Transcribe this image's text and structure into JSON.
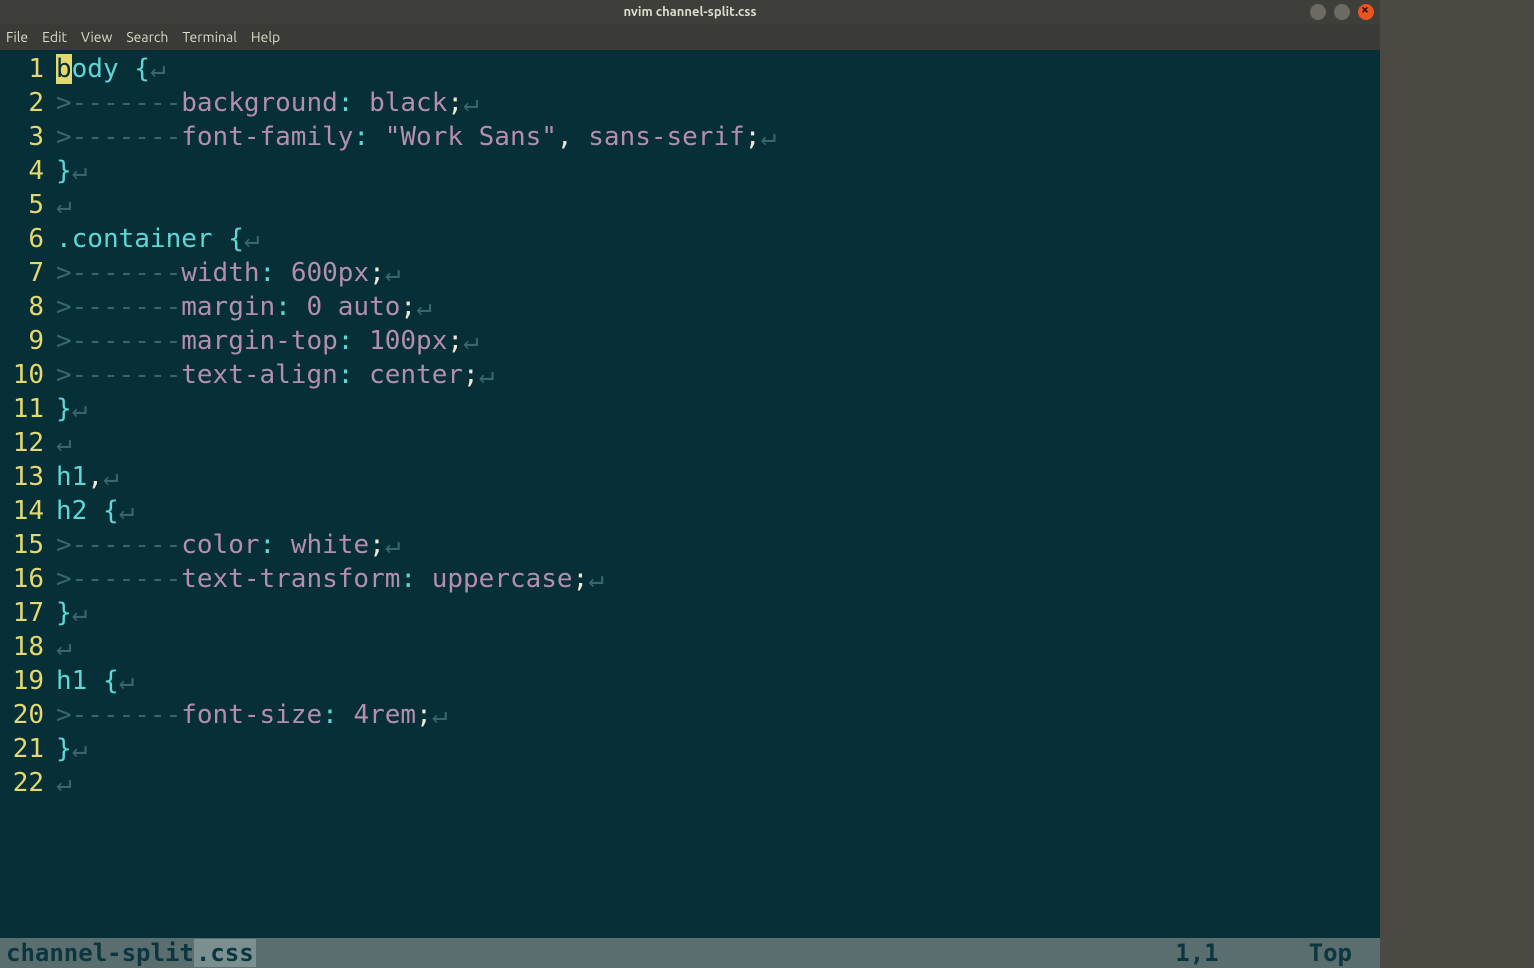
{
  "window": {
    "title": "nvim channel-split.css"
  },
  "menubar": {
    "items": [
      {
        "label": "File"
      },
      {
        "label": "Edit"
      },
      {
        "label": "View"
      },
      {
        "label": "Search"
      },
      {
        "label": "Terminal"
      },
      {
        "label": "Help"
      }
    ]
  },
  "code": {
    "lines": [
      {
        "n": "1",
        "tokens": [
          {
            "t": "b",
            "c": "cursor-block c-selector"
          },
          {
            "t": "ody",
            "c": "c-selector"
          },
          {
            "t": " ",
            "c": "c-text"
          },
          {
            "t": "{",
            "c": "c-punct"
          },
          {
            "t": "↵",
            "c": "c-eol"
          }
        ]
      },
      {
        "n": "2",
        "tokens": [
          {
            "t": ">-------",
            "c": "c-ws"
          },
          {
            "t": "background",
            "c": "c-prop"
          },
          {
            "t": ":",
            "c": "c-punct"
          },
          {
            "t": " ",
            "c": "c-text"
          },
          {
            "t": "black",
            "c": "c-value"
          },
          {
            "t": ";",
            "c": "c-text"
          },
          {
            "t": "↵",
            "c": "c-eol"
          }
        ]
      },
      {
        "n": "3",
        "tokens": [
          {
            "t": ">-------",
            "c": "c-ws"
          },
          {
            "t": "font-family",
            "c": "c-prop"
          },
          {
            "t": ":",
            "c": "c-punct"
          },
          {
            "t": " ",
            "c": "c-text"
          },
          {
            "t": "\"Work Sans\"",
            "c": "c-str"
          },
          {
            "t": ",",
            "c": "c-comma"
          },
          {
            "t": " ",
            "c": "c-text"
          },
          {
            "t": "sans-serif",
            "c": "c-value"
          },
          {
            "t": ";",
            "c": "c-text"
          },
          {
            "t": "↵",
            "c": "c-eol"
          }
        ]
      },
      {
        "n": "4",
        "tokens": [
          {
            "t": "}",
            "c": "c-punct"
          },
          {
            "t": "↵",
            "c": "c-eol"
          }
        ]
      },
      {
        "n": "5",
        "tokens": [
          {
            "t": "↵",
            "c": "c-eol"
          }
        ]
      },
      {
        "n": "6",
        "tokens": [
          {
            "t": ".container",
            "c": "c-selector"
          },
          {
            "t": " ",
            "c": "c-text"
          },
          {
            "t": "{",
            "c": "c-punct"
          },
          {
            "t": "↵",
            "c": "c-eol"
          }
        ]
      },
      {
        "n": "7",
        "tokens": [
          {
            "t": ">-------",
            "c": "c-ws"
          },
          {
            "t": "width",
            "c": "c-prop"
          },
          {
            "t": ":",
            "c": "c-punct"
          },
          {
            "t": " ",
            "c": "c-text"
          },
          {
            "t": "600px",
            "c": "c-num"
          },
          {
            "t": ";",
            "c": "c-text"
          },
          {
            "t": "↵",
            "c": "c-eol"
          }
        ]
      },
      {
        "n": "8",
        "tokens": [
          {
            "t": ">-------",
            "c": "c-ws"
          },
          {
            "t": "margin",
            "c": "c-prop"
          },
          {
            "t": ":",
            "c": "c-punct"
          },
          {
            "t": " ",
            "c": "c-text"
          },
          {
            "t": "0",
            "c": "c-num"
          },
          {
            "t": " ",
            "c": "c-text"
          },
          {
            "t": "auto",
            "c": "c-value"
          },
          {
            "t": ";",
            "c": "c-text"
          },
          {
            "t": "↵",
            "c": "c-eol"
          }
        ]
      },
      {
        "n": "9",
        "tokens": [
          {
            "t": ">-------",
            "c": "c-ws"
          },
          {
            "t": "margin-top",
            "c": "c-prop"
          },
          {
            "t": ":",
            "c": "c-punct"
          },
          {
            "t": " ",
            "c": "c-text"
          },
          {
            "t": "100px",
            "c": "c-num"
          },
          {
            "t": ";",
            "c": "c-text"
          },
          {
            "t": "↵",
            "c": "c-eol"
          }
        ]
      },
      {
        "n": "10",
        "tokens": [
          {
            "t": ">-------",
            "c": "c-ws"
          },
          {
            "t": "text-align",
            "c": "c-prop"
          },
          {
            "t": ":",
            "c": "c-punct"
          },
          {
            "t": " ",
            "c": "c-text"
          },
          {
            "t": "center",
            "c": "c-value"
          },
          {
            "t": ";",
            "c": "c-text"
          },
          {
            "t": "↵",
            "c": "c-eol"
          }
        ]
      },
      {
        "n": "11",
        "tokens": [
          {
            "t": "}",
            "c": "c-punct"
          },
          {
            "t": "↵",
            "c": "c-eol"
          }
        ]
      },
      {
        "n": "12",
        "tokens": [
          {
            "t": "↵",
            "c": "c-eol"
          }
        ]
      },
      {
        "n": "13",
        "tokens": [
          {
            "t": "h1",
            "c": "c-selector"
          },
          {
            "t": ",",
            "c": "c-comma"
          },
          {
            "t": "↵",
            "c": "c-eol"
          }
        ]
      },
      {
        "n": "14",
        "tokens": [
          {
            "t": "h2",
            "c": "c-selector"
          },
          {
            "t": " ",
            "c": "c-text"
          },
          {
            "t": "{",
            "c": "c-punct"
          },
          {
            "t": "↵",
            "c": "c-eol"
          }
        ]
      },
      {
        "n": "15",
        "tokens": [
          {
            "t": ">-------",
            "c": "c-ws"
          },
          {
            "t": "color",
            "c": "c-prop"
          },
          {
            "t": ":",
            "c": "c-punct"
          },
          {
            "t": " ",
            "c": "c-text"
          },
          {
            "t": "white",
            "c": "c-value"
          },
          {
            "t": ";",
            "c": "c-text"
          },
          {
            "t": "↵",
            "c": "c-eol"
          }
        ]
      },
      {
        "n": "16",
        "tokens": [
          {
            "t": ">-------",
            "c": "c-ws"
          },
          {
            "t": "text-transform",
            "c": "c-prop"
          },
          {
            "t": ":",
            "c": "c-punct"
          },
          {
            "t": " ",
            "c": "c-text"
          },
          {
            "t": "uppercase",
            "c": "c-value"
          },
          {
            "t": ";",
            "c": "c-text"
          },
          {
            "t": "↵",
            "c": "c-eol"
          }
        ]
      },
      {
        "n": "17",
        "tokens": [
          {
            "t": "}",
            "c": "c-punct"
          },
          {
            "t": "↵",
            "c": "c-eol"
          }
        ]
      },
      {
        "n": "18",
        "tokens": [
          {
            "t": "↵",
            "c": "c-eol"
          }
        ]
      },
      {
        "n": "19",
        "tokens": [
          {
            "t": "h1",
            "c": "c-selector"
          },
          {
            "t": " ",
            "c": "c-text"
          },
          {
            "t": "{",
            "c": "c-punct"
          },
          {
            "t": "↵",
            "c": "c-eol"
          }
        ]
      },
      {
        "n": "20",
        "tokens": [
          {
            "t": ">-------",
            "c": "c-ws"
          },
          {
            "t": "font-size",
            "c": "c-prop"
          },
          {
            "t": ":",
            "c": "c-punct"
          },
          {
            "t": " ",
            "c": "c-text"
          },
          {
            "t": "4rem",
            "c": "c-num"
          },
          {
            "t": ";",
            "c": "c-text"
          },
          {
            "t": "↵",
            "c": "c-eol"
          }
        ]
      },
      {
        "n": "21",
        "tokens": [
          {
            "t": "}",
            "c": "c-punct"
          },
          {
            "t": "↵",
            "c": "c-eol"
          }
        ]
      },
      {
        "n": "22",
        "tokens": [
          {
            "t": "↵",
            "c": "c-eol"
          }
        ]
      }
    ]
  },
  "statusline": {
    "filename": "channel-split",
    "ext": ".css",
    "position": "1,1",
    "scroll": "Top"
  }
}
